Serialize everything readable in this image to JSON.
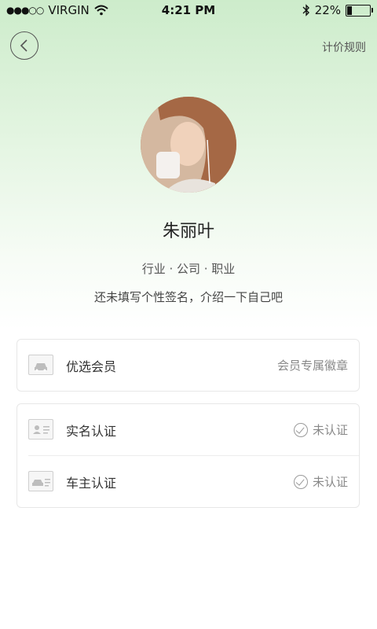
{
  "status_bar": {
    "carrier": "VIRGIN",
    "time": "4:21 PM",
    "battery_text": "22%",
    "battery_level_percent": 22
  },
  "header": {
    "rules_link": "计价规则"
  },
  "profile": {
    "name": "朱丽叶",
    "meta": "行业 · 公司 · 职业",
    "signature": "还未填写个性签名，介绍一下自己吧"
  },
  "membership": {
    "label": "优选会员",
    "right_text": "会员专属徽章"
  },
  "verifications": [
    {
      "label": "实名认证",
      "status": "未认证"
    },
    {
      "label": "车主认证",
      "status": "未认证"
    }
  ]
}
